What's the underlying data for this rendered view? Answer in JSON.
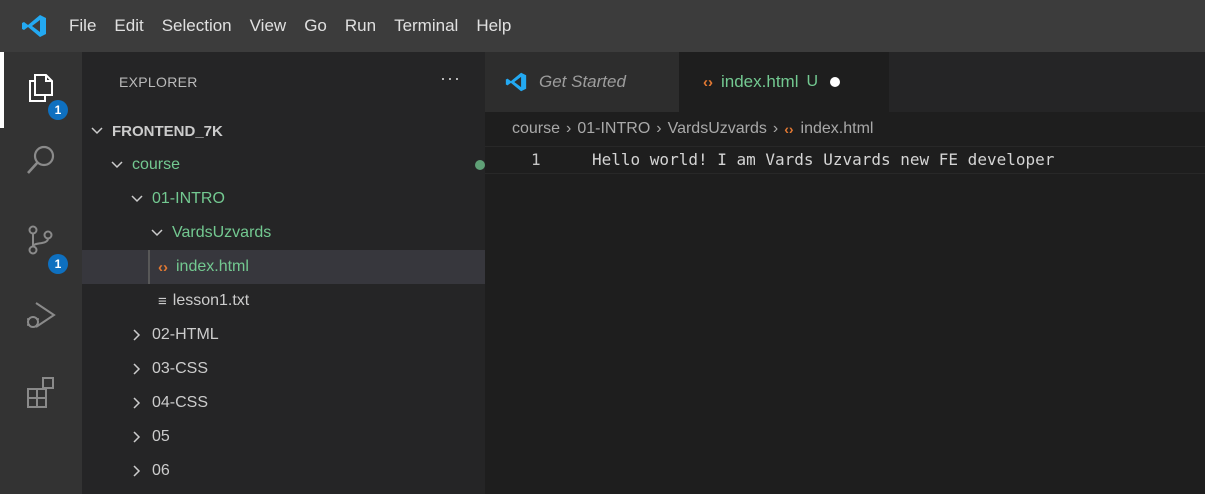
{
  "colors": {
    "titlebar_bg": "#3c3c3c",
    "activitybar_bg": "#333333",
    "sidebar_bg": "#252526",
    "editor_bg": "#1e1e1e",
    "git_untracked": "#73c991",
    "html_icon": "#e37933",
    "badge_bg": "#0e70c0",
    "vscode_blue": "#23a9f2"
  },
  "menu": [
    "File",
    "Edit",
    "Selection",
    "View",
    "Go",
    "Run",
    "Terminal",
    "Help"
  ],
  "activity_bar": {
    "items": [
      {
        "icon": "files-icon",
        "badge": "1"
      },
      {
        "icon": "search-icon"
      },
      {
        "icon": "source-control-icon",
        "badge": "1"
      },
      {
        "icon": "run-debug-icon"
      },
      {
        "icon": "extensions-icon"
      }
    ]
  },
  "sidebar": {
    "title": "EXPLORER",
    "more": "···",
    "tree": [
      {
        "label": "FRONTEND_7K",
        "kind": "root",
        "expanded": true
      },
      {
        "label": "course",
        "kind": "folder",
        "expanded": true,
        "git": "dot"
      },
      {
        "label": "01-INTRO",
        "kind": "folder",
        "expanded": true,
        "git": "dot"
      },
      {
        "label": "VardsUzvards",
        "kind": "folder",
        "expanded": true,
        "git": "dot"
      },
      {
        "label": "index.html",
        "kind": "html",
        "git": "U",
        "selected": true
      },
      {
        "label": "lesson1.txt",
        "kind": "text"
      },
      {
        "label": "02-HTML",
        "kind": "folder",
        "expanded": false
      },
      {
        "label": "03-CSS",
        "kind": "folder",
        "expanded": false
      },
      {
        "label": "04-CSS",
        "kind": "folder",
        "expanded": false
      },
      {
        "label": "05",
        "kind": "folder",
        "expanded": false
      },
      {
        "label": "06",
        "kind": "folder",
        "expanded": false
      }
    ]
  },
  "tabs": [
    {
      "label": "Get Started",
      "active": false
    },
    {
      "label": "index.html",
      "status": "U",
      "active": true,
      "dirty": true
    }
  ],
  "breadcrumb": [
    "course",
    "01-INTRO",
    "VardsUzvards",
    "index.html"
  ],
  "editor": {
    "lines": [
      {
        "number": "1",
        "text": "Hello world! I am Vards Uzvards new FE developer"
      }
    ]
  }
}
